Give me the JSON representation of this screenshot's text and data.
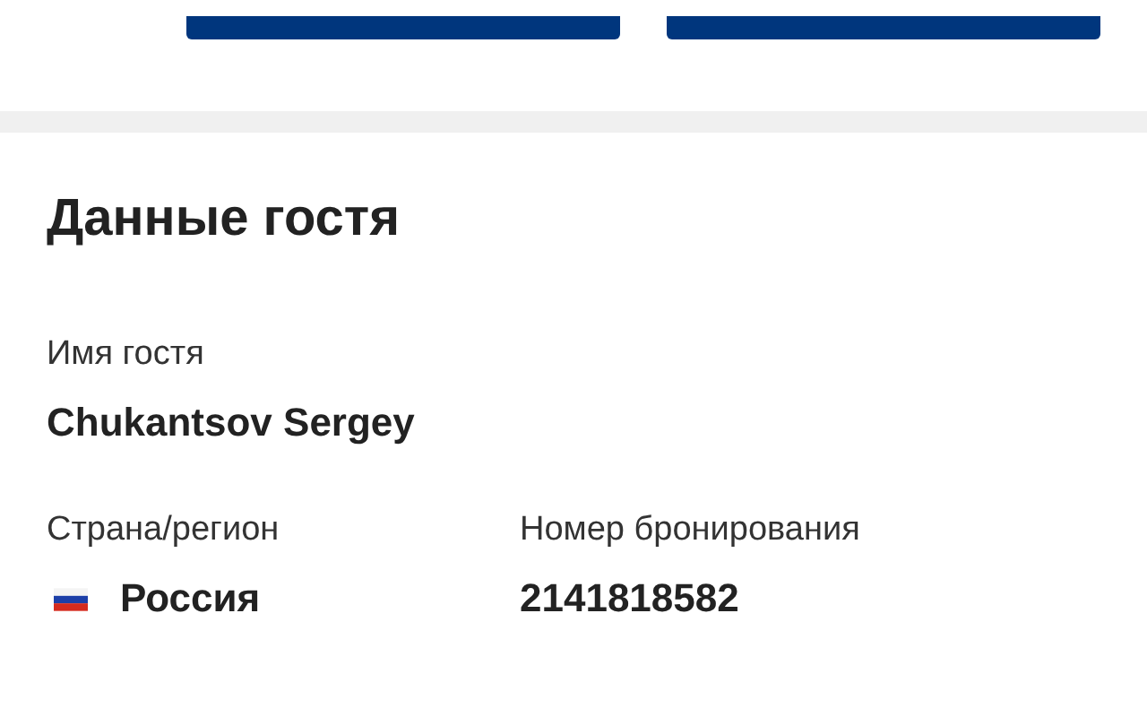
{
  "section": {
    "title": "Данные гостя"
  },
  "fields": [
    {
      "label": "Имя гостя",
      "value": "Chukantsov Sergey",
      "kind": "text"
    },
    {
      "label": "Страна/регион",
      "value": "Россия",
      "kind": "country"
    },
    {
      "label": "Номер бронирования",
      "value": "2141818582",
      "kind": "text"
    }
  ]
}
